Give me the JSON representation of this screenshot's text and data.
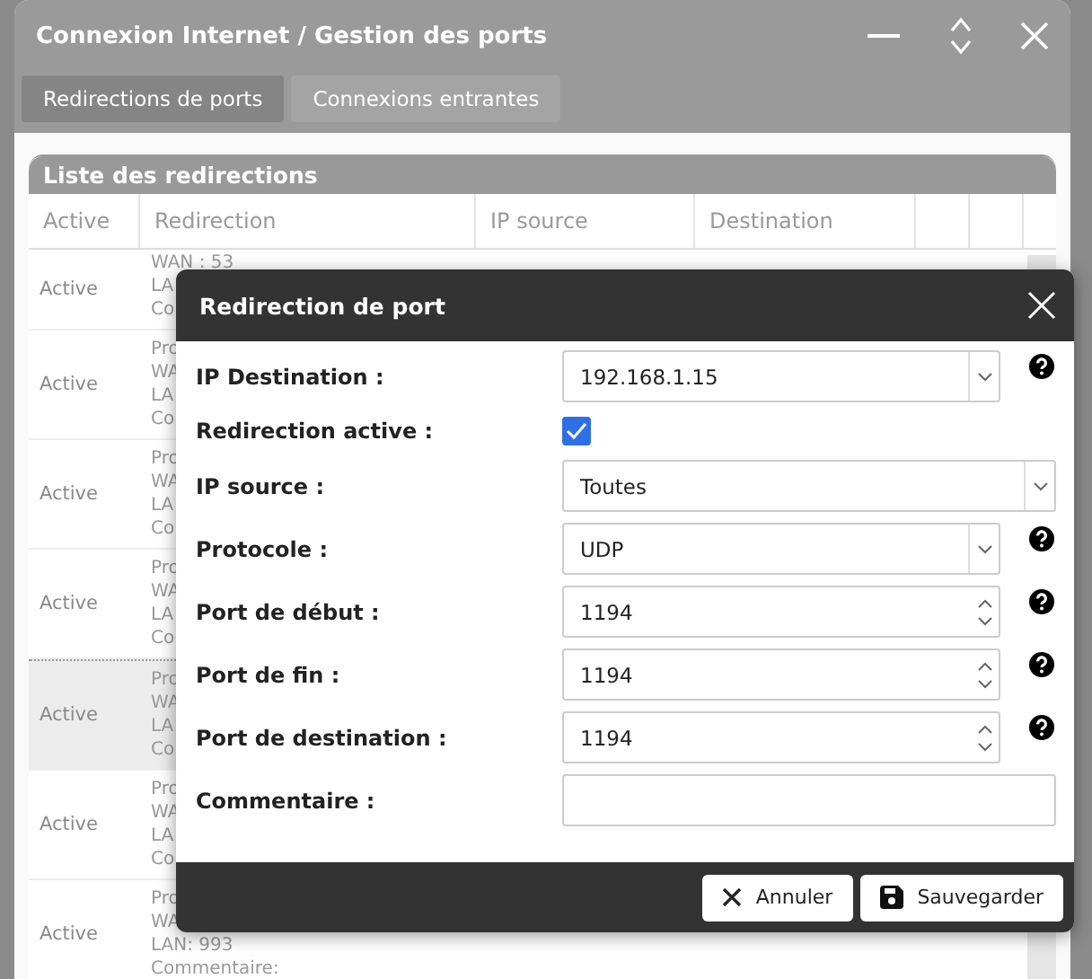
{
  "window": {
    "title": "Connexion Internet / Gestion des ports"
  },
  "tabs": [
    {
      "label": "Redirections de ports",
      "selected": true
    },
    {
      "label": "Connexions entrantes",
      "selected": false
    }
  ],
  "list": {
    "title": "Liste des redirections",
    "columns": [
      "Active",
      "Redirection",
      "IP source",
      "Destination"
    ],
    "rows": [
      {
        "active": "Active",
        "lines": [
          "WAN : 53",
          "LA",
          "Co"
        ],
        "selected": false
      },
      {
        "active": "Active",
        "lines": [
          "Pro",
          "WA",
          "LA",
          "Co"
        ],
        "selected": false
      },
      {
        "active": "Active",
        "lines": [
          "Pro",
          "WA",
          "LA",
          "Co"
        ],
        "selected": false
      },
      {
        "active": "Active",
        "lines": [
          "Pro",
          "WA",
          "LA",
          "Co"
        ],
        "selected": false
      },
      {
        "active": "Active",
        "lines": [
          "Pro",
          "WA",
          "LA",
          "Co"
        ],
        "selected": true
      },
      {
        "active": "Active",
        "lines": [
          "Pro",
          "WA",
          "LA",
          "Co"
        ],
        "selected": false
      },
      {
        "active": "Active",
        "lines": [
          "Pro",
          "WA",
          "LAN: 993",
          "Commentaire:"
        ],
        "selected": false
      }
    ]
  },
  "dialog": {
    "title": "Redirection de port",
    "fields": [
      {
        "kind": "select",
        "label": "IP Destination :",
        "value": "192.168.1.15",
        "help": true
      },
      {
        "kind": "checkbox",
        "label": "Redirection active :",
        "checked": true
      },
      {
        "kind": "select",
        "label": "IP source :",
        "value": "Toutes",
        "help": false
      },
      {
        "kind": "select",
        "label": "Protocole :",
        "value": "UDP",
        "help": true
      },
      {
        "kind": "number",
        "label": "Port de début :",
        "value": "1194",
        "help": true
      },
      {
        "kind": "number",
        "label": "Port de fin :",
        "value": "1194",
        "help": true
      },
      {
        "kind": "number",
        "label": "Port de destination :",
        "value": "1194",
        "help": true
      },
      {
        "kind": "text",
        "label": "Commentaire :",
        "help": false
      }
    ],
    "buttons": [
      {
        "kind": "cancel",
        "label": "Annuler"
      },
      {
        "kind": "save",
        "label": "Sauvegarder"
      }
    ]
  }
}
